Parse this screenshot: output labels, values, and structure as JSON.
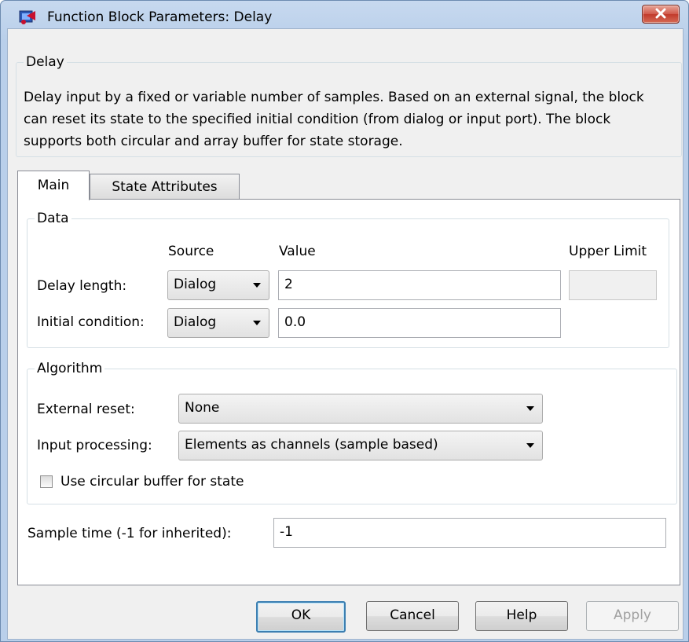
{
  "window": {
    "title": "Function Block Parameters: Delay"
  },
  "block": {
    "group_label": "Delay",
    "description": "Delay input by a fixed or variable number of samples. Based on an external signal, the block can reset its state to the specified initial condition (from dialog or input port). The block supports both circular and array buffer for state storage."
  },
  "tabs": [
    {
      "label": "Main",
      "selected": true
    },
    {
      "label": "State Attributes",
      "selected": false
    }
  ],
  "data_group": {
    "label": "Data",
    "col_source": "Source",
    "col_value": "Value",
    "col_upper_limit": "Upper Limit",
    "delay_length": {
      "label": "Delay length:",
      "source": "Dialog",
      "value": "2",
      "upper_limit": ""
    },
    "initial_condition": {
      "label": "Initial condition:",
      "source": "Dialog",
      "value": "0.0"
    }
  },
  "algorithm_group": {
    "label": "Algorithm",
    "external_reset": {
      "label": "External reset:",
      "value": "None"
    },
    "input_processing": {
      "label": "Input processing:",
      "value": "Elements as channels (sample based)"
    },
    "circular_buffer": {
      "label": "Use circular buffer for state",
      "checked": false
    }
  },
  "sample_time": {
    "label": "Sample time (-1 for inherited):",
    "value": "-1"
  },
  "buttons": {
    "ok": "OK",
    "cancel": "Cancel",
    "help": "Help",
    "apply": "Apply"
  },
  "icons": {
    "app": "simulink-block-icon",
    "close": "close-icon",
    "dropdown": "chevron-down-icon"
  },
  "colors": {
    "frame": "#b9cfea",
    "close_button": "#c13a2b",
    "default_button_border": "#3c7fb1"
  }
}
